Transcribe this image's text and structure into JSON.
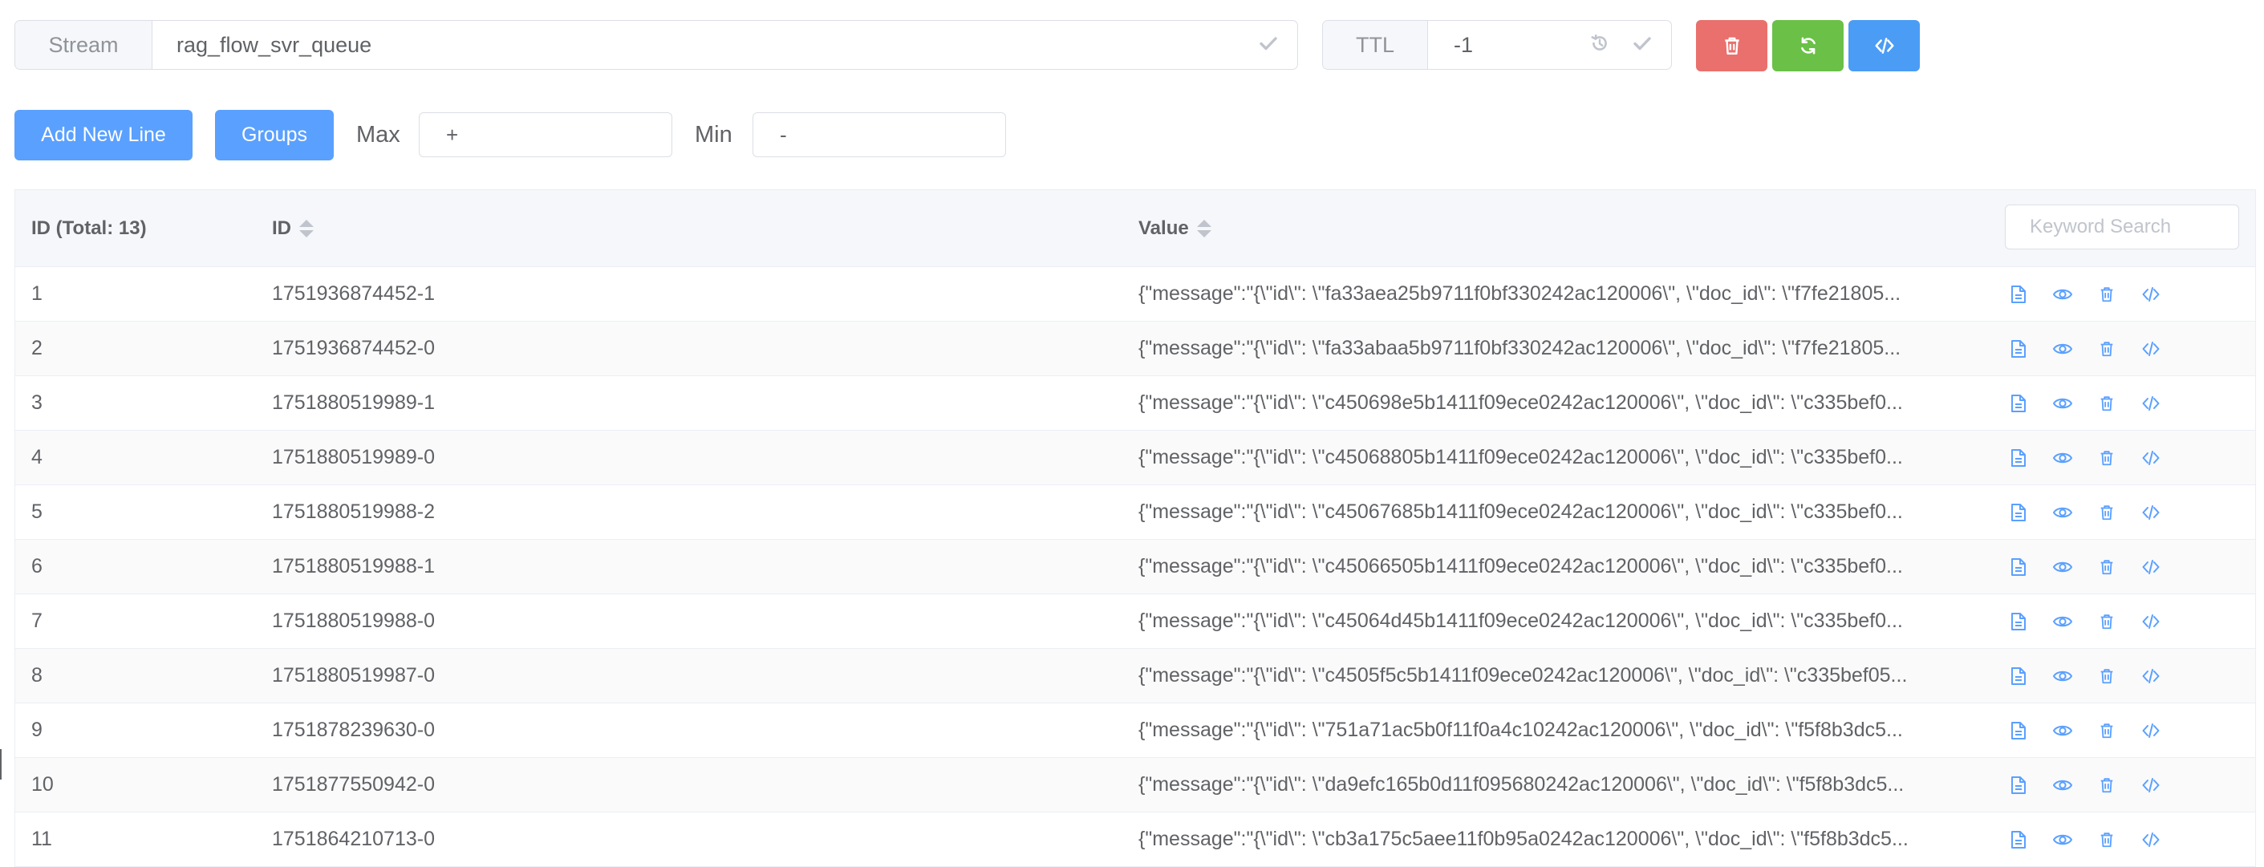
{
  "toolbar": {
    "stream_label": "Stream",
    "stream_value": "rag_flow_svr_queue",
    "ttl_label": "TTL",
    "ttl_value": "-1",
    "delete_color": "#e9706c",
    "refresh_color": "#6bc048",
    "dump_color": "#4b9cf5"
  },
  "controls": {
    "add_line_label": "Add New Line",
    "groups_label": "Groups",
    "max_label": "Max",
    "max_value": "+",
    "min_label": "Min",
    "min_value": "-"
  },
  "table": {
    "header_index": "ID (Total: 13)",
    "header_id": "ID",
    "header_value": "Value",
    "search_placeholder": "Keyword Search",
    "rows": [
      {
        "index": "1",
        "id": "1751936874452-1",
        "value": "{\"message\":\"{\\\"id\\\": \\\"fa33aea25b9711f0bf330242ac120006\\\", \\\"doc_id\\\": \\\"f7fe21805..."
      },
      {
        "index": "2",
        "id": "1751936874452-0",
        "value": "{\"message\":\"{\\\"id\\\": \\\"fa33abaa5b9711f0bf330242ac120006\\\", \\\"doc_id\\\": \\\"f7fe21805..."
      },
      {
        "index": "3",
        "id": "1751880519989-1",
        "value": "{\"message\":\"{\\\"id\\\": \\\"c450698e5b1411f09ece0242ac120006\\\", \\\"doc_id\\\": \\\"c335bef0..."
      },
      {
        "index": "4",
        "id": "1751880519989-0",
        "value": "{\"message\":\"{\\\"id\\\": \\\"c45068805b1411f09ece0242ac120006\\\", \\\"doc_id\\\": \\\"c335bef0..."
      },
      {
        "index": "5",
        "id": "1751880519988-2",
        "value": "{\"message\":\"{\\\"id\\\": \\\"c45067685b1411f09ece0242ac120006\\\", \\\"doc_id\\\": \\\"c335bef0..."
      },
      {
        "index": "6",
        "id": "1751880519988-1",
        "value": "{\"message\":\"{\\\"id\\\": \\\"c45066505b1411f09ece0242ac120006\\\", \\\"doc_id\\\": \\\"c335bef0..."
      },
      {
        "index": "7",
        "id": "1751880519988-0",
        "value": "{\"message\":\"{\\\"id\\\": \\\"c45064d45b1411f09ece0242ac120006\\\", \\\"doc_id\\\": \\\"c335bef0..."
      },
      {
        "index": "8",
        "id": "1751880519987-0",
        "value": "{\"message\":\"{\\\"id\\\": \\\"c4505f5c5b1411f09ece0242ac120006\\\", \\\"doc_id\\\": \\\"c335bef05..."
      },
      {
        "index": "9",
        "id": "1751878239630-0",
        "value": "{\"message\":\"{\\\"id\\\": \\\"751a71ac5b0f11f0a4c10242ac120006\\\", \\\"doc_id\\\": \\\"f5f8b3dc5..."
      },
      {
        "index": "10",
        "id": "1751877550942-0",
        "value": "{\"message\":\"{\\\"id\\\": \\\"da9efc165b0d11f095680242ac120006\\\", \\\"doc_id\\\": \\\"f5f8b3dc5..."
      },
      {
        "index": "11",
        "id": "1751864210713-0",
        "value": "{\"message\":\"{\\\"id\\\": \\\"cb3a175c5aee11f0b95a0242ac120006\\\", \\\"doc_id\\\": \\\"f5f8b3dc5..."
      }
    ],
    "row_actions": [
      "copy-icon",
      "view-icon",
      "delete-icon",
      "dump-icon"
    ],
    "action_color": "#5aa0ff"
  }
}
